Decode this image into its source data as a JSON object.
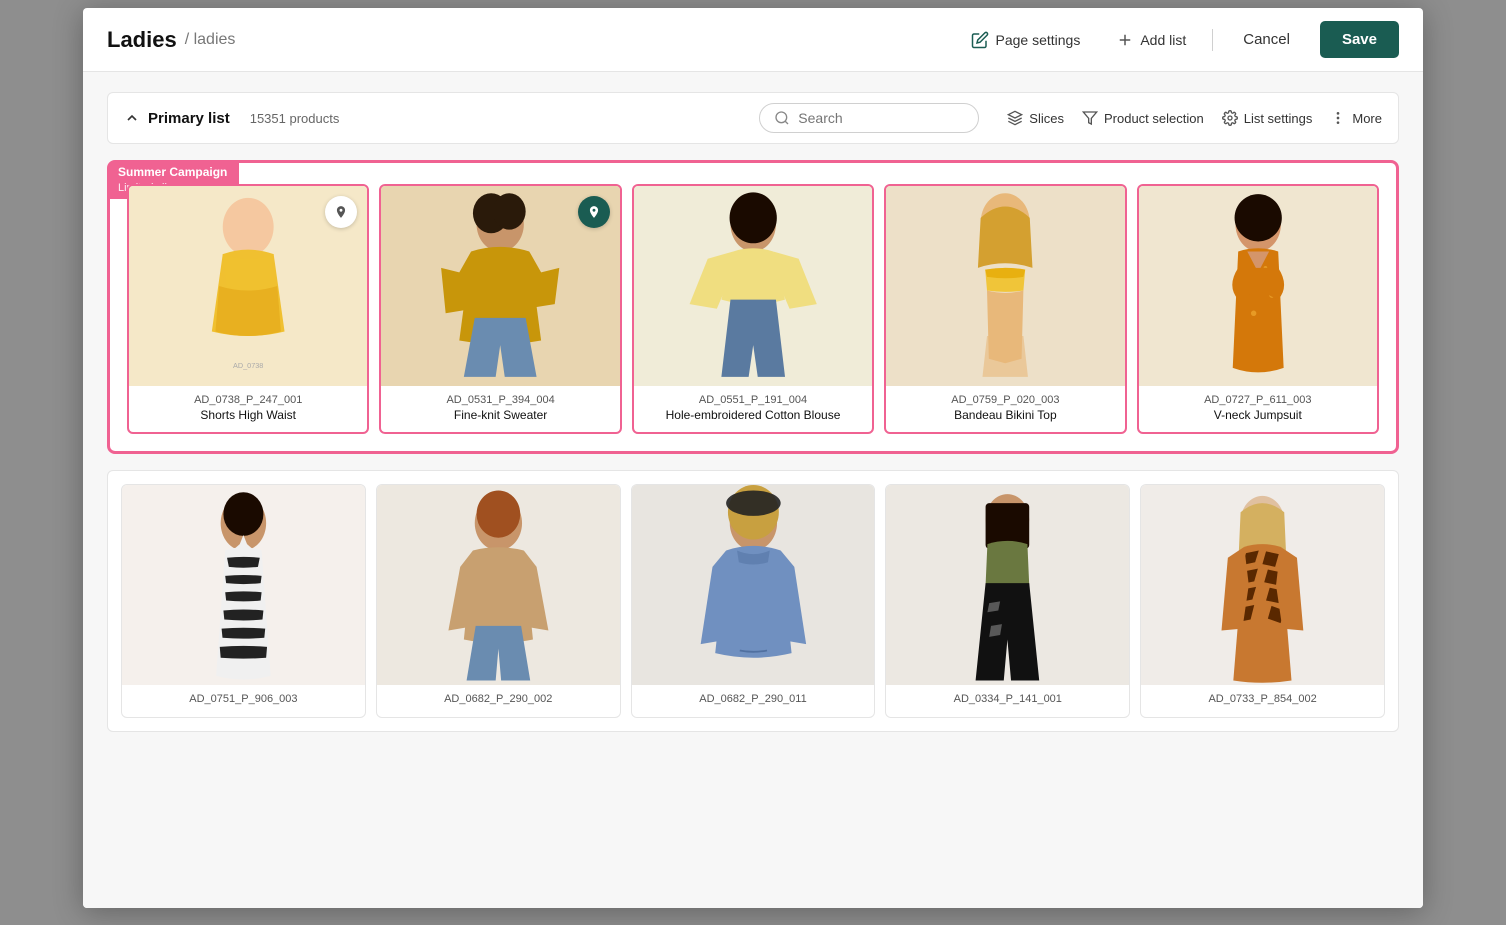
{
  "header": {
    "title": "Ladies",
    "breadcrumb": "/ ladies",
    "page_settings_label": "Page settings",
    "add_list_label": "Add list",
    "cancel_label": "Cancel",
    "save_label": "Save"
  },
  "toolbar": {
    "primary_list_label": "Primary list",
    "product_count": "15351 products",
    "search_placeholder": "Search",
    "slices_label": "Slices",
    "product_selection_label": "Product selection",
    "list_settings_label": "List settings",
    "more_label": "More"
  },
  "campaign": {
    "name": "Summer Campaign",
    "type": "Limited slice"
  },
  "products_row1": [
    {
      "id": "AD_0738_P_247_001",
      "name": "Shorts High Waist",
      "pinned": true,
      "color": "#f5e8c8"
    },
    {
      "id": "AD_0531_P_394_004",
      "name": "Fine-knit Sweater",
      "pinned": true,
      "color": "#e8d5b0"
    },
    {
      "id": "AD_0551_P_191_004",
      "name": "Hole-embroidered Cotton Blouse",
      "pinned": false,
      "color": "#f0ecd8"
    },
    {
      "id": "AD_0759_P_020_003",
      "name": "Bandeau Bikini Top",
      "pinned": false,
      "color": "#ede0c8"
    },
    {
      "id": "AD_0727_P_611_003",
      "name": "V-neck Jumpsuit",
      "pinned": false,
      "color": "#f0e6d0"
    }
  ],
  "products_row2": [
    {
      "id": "AD_0751_P_906_003",
      "name": "",
      "color": "#f5f0ec"
    },
    {
      "id": "AD_0682_P_290_002",
      "name": "",
      "color": "#ede8e0"
    },
    {
      "id": "AD_0682_P_290_011",
      "name": "",
      "color": "#e8e5e0"
    },
    {
      "id": "AD_0334_P_141_001",
      "name": "",
      "color": "#ece8e2"
    },
    {
      "id": "AD_0733_P_854_002",
      "name": "",
      "color": "#f0ece8"
    }
  ]
}
